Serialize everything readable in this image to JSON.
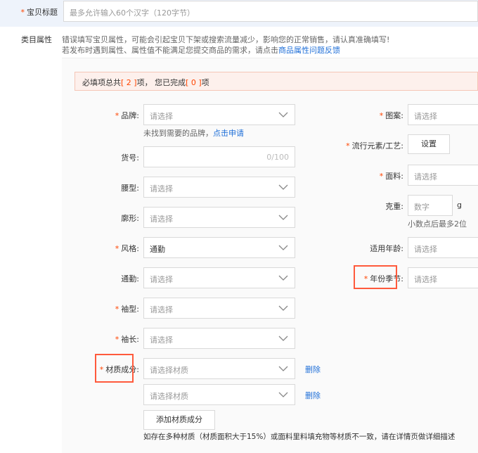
{
  "title_row": {
    "label": "宝贝标题",
    "placeholder": "最多允许输入60个汉字（120字节）"
  },
  "category": {
    "label": "类目属性",
    "notice_line1": "错误填写宝贝属性，可能会引起宝贝下架或搜索流量减少，影响您的正常销售，请认真准确填写!",
    "notice_line2_prefix": "若发布时遇到属性、属性值不能满足您提交商品的需求，请点击",
    "notice_line2_link": "商品属性问题反馈"
  },
  "required_banner": {
    "prefix": "必填项总共",
    "total": "[ 2 ]",
    "middle": "项，  您已完成",
    "done": "[ 0 ]",
    "suffix": "项"
  },
  "left": {
    "brand": {
      "label": "品牌",
      "placeholder": "请选择",
      "hint": "未找到需要的品牌，",
      "hint_link": "点击申请"
    },
    "item_no": {
      "label": "货号",
      "counter": "0/100"
    },
    "waist": {
      "label": "腰型",
      "placeholder": "请选择"
    },
    "silhouette": {
      "label": "廓形",
      "placeholder": "请选择"
    },
    "style": {
      "label": "风格",
      "value": "通勤"
    },
    "commute": {
      "label": "通勤",
      "placeholder": "请选择"
    },
    "sleeve_type": {
      "label": "袖型",
      "placeholder": "请选择"
    },
    "sleeve_length": {
      "label": "袖长",
      "placeholder": "请选择"
    },
    "material": {
      "label": "材质成分",
      "placeholder": "请选择材质",
      "delete": "删除"
    },
    "material2": {
      "placeholder": "请选择材质",
      "delete": "删除"
    },
    "add_material": "添加材质成分",
    "footnote": "如存在多种材质（材质面积大于15%）或面料里料填充物等材质不一致，请在详情页做详细描述"
  },
  "right": {
    "pattern": {
      "label": "图案",
      "placeholder": "请选择"
    },
    "trend": {
      "label": "流行元素/工艺",
      "button": "设置"
    },
    "fabric": {
      "label": "面料",
      "placeholder": "请选择"
    },
    "weight": {
      "label": "克重",
      "placeholder": "数字",
      "unit": "g",
      "hint": "小数点后最多2位"
    },
    "age": {
      "label": "适用年龄",
      "placeholder": "请选择"
    },
    "season": {
      "label": "年份季节",
      "placeholder": "请选择"
    }
  },
  "colors": {
    "accent": "#ff4400",
    "link": "#1f6fd8",
    "highlight": "#ff5a3c",
    "banner_bg": "#fdf0ec"
  }
}
